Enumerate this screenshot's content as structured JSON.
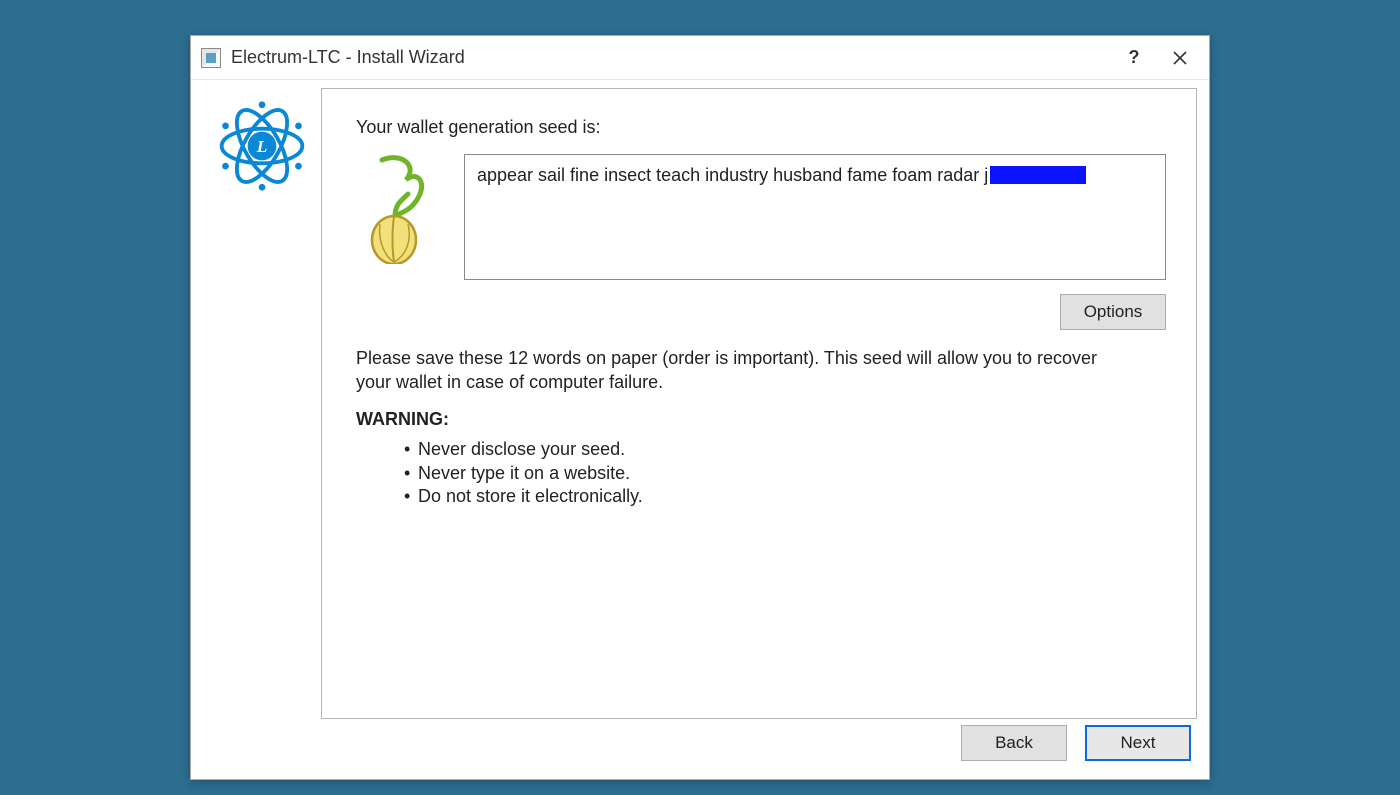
{
  "titlebar": {
    "title": "Electrum-LTC  -  Install Wizard"
  },
  "content": {
    "seed_label": "Your wallet generation seed is:",
    "seed_text_visible": "appear sail fine insect teach industry husband fame foam radar j",
    "options_button": "Options",
    "instructions": "Please save these 12 words on paper (order is important). This seed will allow you to recover your wallet in case of computer failure.",
    "warning_heading": "WARNING:",
    "warning_items": [
      "Never disclose your seed.",
      "Never type it on a website.",
      "Do not store it electronically."
    ]
  },
  "footer": {
    "back": "Back",
    "next": "Next"
  }
}
